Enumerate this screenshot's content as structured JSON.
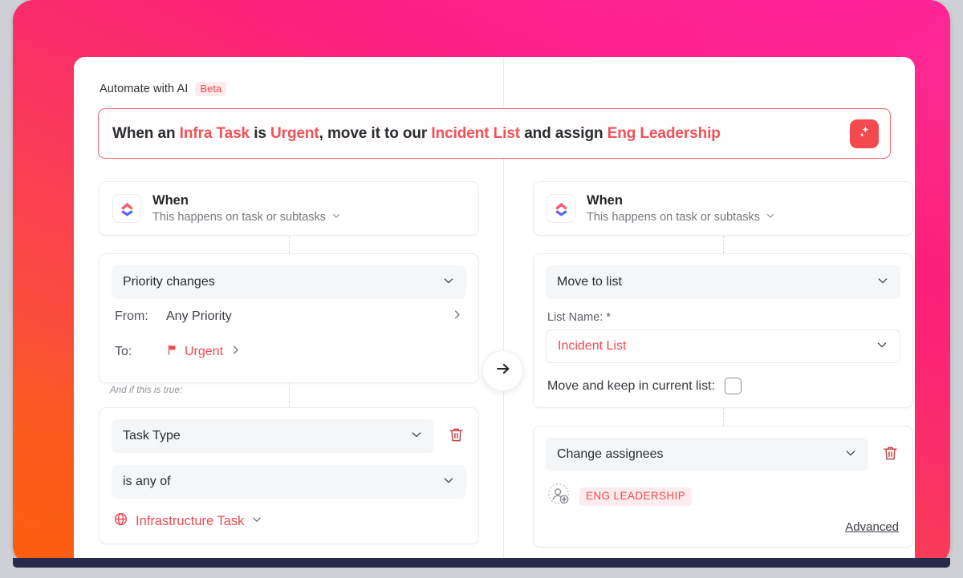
{
  "header": {
    "title": "Automate with AI",
    "badge": "Beta"
  },
  "prompt": {
    "segments": [
      {
        "text": "When an ",
        "highlight": false
      },
      {
        "text": "Infra Task",
        "highlight": true
      },
      {
        "text": " is ",
        "highlight": false
      },
      {
        "text": "Urgent",
        "highlight": true
      },
      {
        "text": ", move it to our ",
        "highlight": false
      },
      {
        "text": "Incident List",
        "highlight": true
      },
      {
        "text": " and assign ",
        "highlight": false
      },
      {
        "text": "Eng Leadership",
        "highlight": true
      }
    ],
    "generate_icon": "sparkle-icon"
  },
  "flow_arrow": {
    "icon": "arrow-right-icon"
  },
  "trigger": {
    "logo_icon": "clickup-logo-icon",
    "title": "When",
    "subtitle": "This happens on task or subtasks",
    "chevron_icon": "chevron-down-icon"
  },
  "left_column": {
    "trigger_card": {
      "title": "When",
      "subtitle": "This happens on task or subtasks"
    },
    "condition_card": {
      "event_select": "Priority changes",
      "from_label": "From:",
      "from_value": "Any Priority",
      "to_label": "To:",
      "to_value": "Urgent",
      "to_icon": "flag-icon"
    },
    "and_if_label": "And if this is true:",
    "filter_card": {
      "field_select": "Task Type",
      "operator_select": "is any of",
      "value_tag": "Infrastructure Task",
      "value_icon": "globe-icon",
      "delete_icon": "trash-icon"
    }
  },
  "right_column": {
    "trigger_card": {
      "title": "When",
      "subtitle": "This happens on task or subtasks"
    },
    "move_card": {
      "action_select": "Move to list",
      "list_name_label": "List Name: *",
      "list_name_value": "Incident List",
      "keep_label": "Move and keep in current list:",
      "keep_checked": false
    },
    "assignee_card": {
      "action_select": "Change assignees",
      "delete_icon": "trash-icon",
      "add_person_icon": "add-person-icon",
      "assignee_pill": "ENG LEADERSHIP",
      "advanced_link": "Advanced"
    }
  },
  "colors": {
    "accent_red": "#ef4b53",
    "prompt_border": "#f2676b",
    "badge_bg": "#fdeced",
    "gradient_start": "#ff3d8b",
    "gradient_end": "#fb5e16",
    "chrome_bar": "#272a4a"
  }
}
